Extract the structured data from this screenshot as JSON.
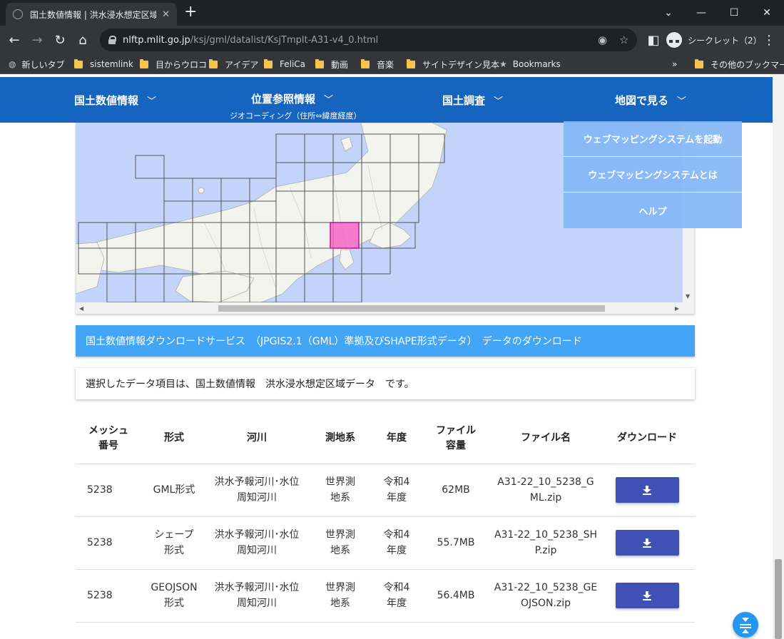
{
  "browser": {
    "tab_title": "国土数値情報 | 洪水浸水想定区域",
    "url_host": "nlftp.mlit.go.jp",
    "url_path": "/ksj/gml/datalist/KsjTmplt-A31-v4_0.html",
    "profile_label": "シークレット（2）",
    "bookmarks": [
      "新しいタブ",
      "sistemlink",
      "目からウロコ",
      "アイデア",
      "FeliCa",
      "動画",
      "音楽",
      "サイトデザイン見本",
      "Bookmarks"
    ],
    "other_bookmarks": "その他のブックマーク",
    "bookmarks_overflow": "»"
  },
  "site_nav": {
    "items": [
      "国土数値情報",
      "位置参照情報",
      "国土調査",
      "地図で見る"
    ],
    "sub_label": "ジオコーディング（住所⇔緯度経度）"
  },
  "map": {
    "wms_menu": [
      "ウェブマッピングシステムを起動",
      "ウェブマッピングシステムとは",
      "ヘルプ"
    ],
    "highlight_color": "#f25fc2",
    "water_color": "#c3d3f9"
  },
  "download_banner": "国土数値情報ダウンロードサービス　（JPGIS2.1（GML）準拠及びSHAPE形式データ）　データのダウンロード",
  "selection_text": "選択したデータ項目は、国土数値情報　洪水浸水想定区域データ　です。",
  "table": {
    "headers": {
      "mesh_1": "メッシュ",
      "mesh_2": "番号",
      "format": "形式",
      "river": "河川",
      "datum": "測地系",
      "year": "年度",
      "size_1": "ファイル",
      "size_2": "容量",
      "filename": "ファイル名",
      "download": "ダウンロード"
    },
    "rows": [
      {
        "mesh": "5238",
        "format_1": "GML形式",
        "format_2": "",
        "river_1": "洪水予報河川･水位",
        "river_2": "周知河川",
        "datum_1": "世界測",
        "datum_2": "地系",
        "year_1": "令和4",
        "year_2": "年度",
        "size": "62MB",
        "file_1": "A31-22_10_5238_G",
        "file_2": "ML.zip"
      },
      {
        "mesh": "5238",
        "format_1": "シェープ",
        "format_2": "形式",
        "river_1": "洪水予報河川･水位",
        "river_2": "周知河川",
        "datum_1": "世界測",
        "datum_2": "地系",
        "year_1": "令和4",
        "year_2": "年度",
        "size": "55.7MB",
        "file_1": "A31-22_10_5238_SH",
        "file_2": "P.zip"
      },
      {
        "mesh": "5238",
        "format_1": "GEOJSON",
        "format_2": "形式",
        "river_1": "洪水予報河川･水位",
        "river_2": "周知河川",
        "datum_1": "世界測",
        "datum_2": "地系",
        "year_1": "令和4",
        "year_2": "年度",
        "size": "56.4MB",
        "file_1": "A31-22_10_5238_GE",
        "file_2": "OJSON.zip"
      }
    ]
  },
  "colors": {
    "site_nav": "#1565c0",
    "banner": "#42a5f5",
    "download_button": "#3f51b5",
    "fab": "#2196f3"
  }
}
